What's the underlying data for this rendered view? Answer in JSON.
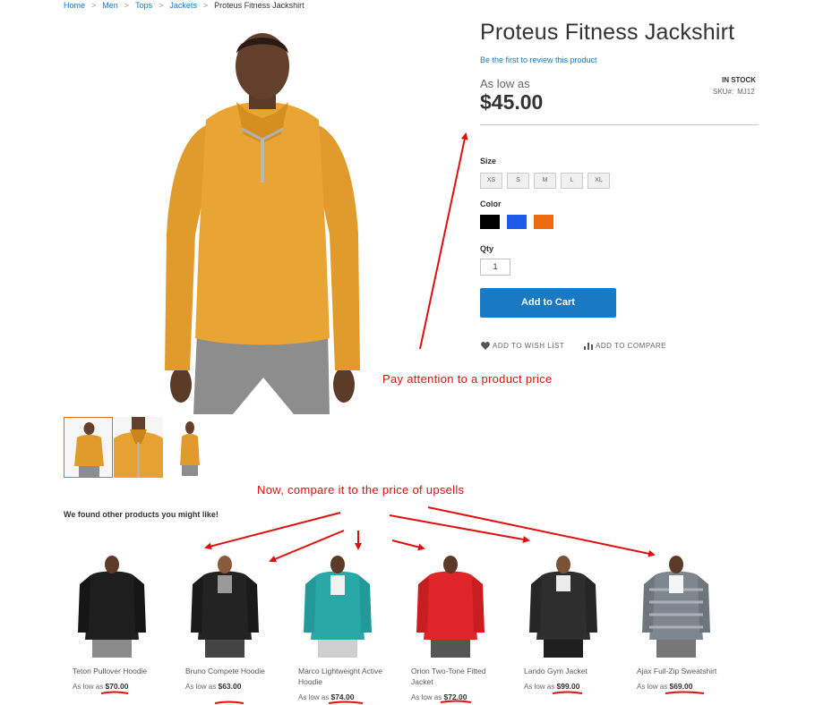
{
  "breadcrumbs": [
    "Home",
    "Men",
    "Tops",
    "Jackets",
    "Proteus Fitness Jackshirt"
  ],
  "breadcrumb_separator": ">",
  "product": {
    "title": "Proteus Fitness Jackshirt",
    "review_link": "Be the first to review this product",
    "price_label": "As low as",
    "price": "$45.00",
    "stock": "IN STOCK",
    "sku_label": "SKU#:",
    "sku": "MJ12",
    "size_label": "Size",
    "sizes": [
      "XS",
      "S",
      "M",
      "L",
      "XL"
    ],
    "color_label": "Color",
    "colors": [
      "#000000",
      "#1d5be8",
      "#eb6b0f"
    ],
    "qty_label": "Qty",
    "qty_value": "1",
    "add_to_cart": "Add to Cart",
    "wishlist": "ADD TO WISH LIST",
    "compare": "ADD TO COMPARE",
    "thumbnails": [
      "front-view",
      "closeup-view",
      "side-view"
    ]
  },
  "annotations": {
    "price_note": "Pay attention to a product price",
    "compare_note": "Now, compare it to the price of upsells"
  },
  "upsells": {
    "title": "We found other products you might like!",
    "items": [
      {
        "name": "Teton Pullover Hoodie",
        "price_label": "As low as",
        "price": "$70.00",
        "color": "#1e1e1e"
      },
      {
        "name": "Bruno Compete Hoodie",
        "price_label": "As low as",
        "price": "$63.00",
        "color": "#232323"
      },
      {
        "name": "Marco Lightweight Active Hoodie",
        "price_label": "As low as",
        "price": "$74.00",
        "color": "#2aa8a8"
      },
      {
        "name": "Orion Two-Tone Fitted Jacket",
        "price_label": "As low as",
        "price": "$72.00",
        "color": "#e0252a"
      },
      {
        "name": "Lando Gym Jacket",
        "price_label": "As low as",
        "price": "$99.00",
        "color": "#2e2e2e"
      },
      {
        "name": "Ajax Full-Zip Sweatshirt",
        "price_label": "As low as",
        "price": "$69.00",
        "color": "#7e8790"
      }
    ]
  },
  "colors": {
    "accent": "#1979c3",
    "annotation": "#e01010",
    "jacket": "#e5a337"
  }
}
